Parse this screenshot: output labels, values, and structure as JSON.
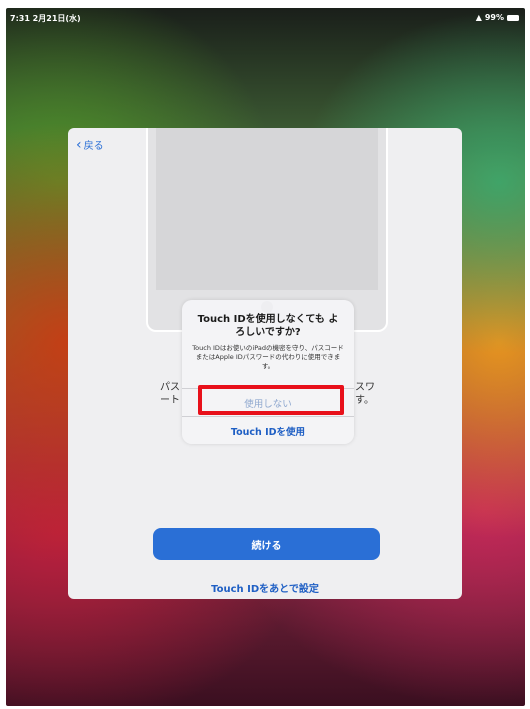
{
  "status_bar": {
    "time": "7:31 2月21日(水)",
    "battery": "99%"
  },
  "setup": {
    "back_label": "戻る",
    "description_left": [
      "パス",
      "ート"
    ],
    "description_right": [
      "スワ",
      "す。"
    ],
    "continue_label": "続ける",
    "setup_later_label": "Touch IDをあとで設定"
  },
  "alert": {
    "title": "Touch IDを使用しなくても よろしいですか?",
    "message": "Touch IDはお使いのiPadの機密を守り、パスコードまたはApple IDパスワードの代わりに使用できます。",
    "dont_use_label": "使用しない",
    "use_label": "Touch IDを使用"
  },
  "annotation": {
    "highlight_color": "#e8101a"
  },
  "colors": {
    "accent": "#2a6fd6"
  }
}
